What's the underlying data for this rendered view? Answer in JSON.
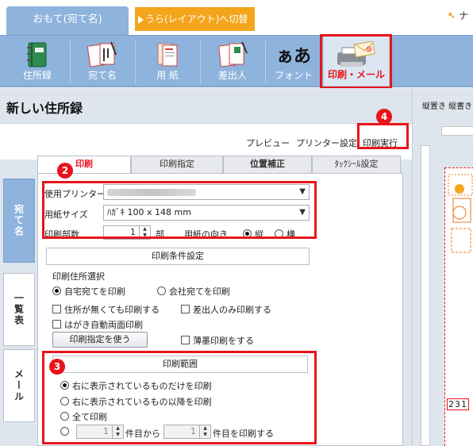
{
  "tabs": {
    "front": "おもて(宛て名)",
    "back": "うら(レイアウト)へ切替",
    "help": "ナ"
  },
  "toolbar": [
    {
      "label": "住所録",
      "icon": "address-book-icon"
    },
    {
      "label": "宛て名",
      "icon": "address-label-icon"
    },
    {
      "label": "用 紙",
      "icon": "paper-icon"
    },
    {
      "label": "差出人",
      "icon": "sender-icon"
    },
    {
      "label": "フォント",
      "icon": "font-icon",
      "glyph": "ぁあ"
    },
    {
      "label": "印刷・メール",
      "icon": "printer-mail-icon"
    }
  ],
  "title": "新しい住所録",
  "commands": {
    "preview": "プレビュー",
    "printer_setup": "プリンター設定",
    "print_exec": "印刷実行"
  },
  "side_tabs": [
    "宛て名",
    "一覧表",
    "メール"
  ],
  "print_tabs": [
    "印刷",
    "印刷指定",
    "位置補正",
    "ﾀｯｸｼｰﾙ設定"
  ],
  "form": {
    "printer_label": "使用プリンター",
    "paper_label": "用紙サイズ",
    "paper_value": "ﾊｶﾞｷ 100 x 148 mm",
    "copies_label": "印刷部数",
    "copies_value": "1",
    "copies_unit": "部",
    "orientation_label": "用紙の向き",
    "orientation_portrait": "縦",
    "orientation_landscape": "横"
  },
  "conditions": {
    "header": "印刷条件設定",
    "addr_select_label": "印刷住所選択",
    "home": "自宅宛てを印刷",
    "office": "会社宛てを印刷",
    "no_address": "住所が無くても印刷する",
    "sender_only": "差出人のみ印刷する",
    "duplex": "はがき自動両面印刷",
    "use_spec_button": "印刷指定を使う",
    "light_print": "薄墨印刷をする"
  },
  "range": {
    "header": "印刷範囲",
    "opt_shown_only": "右に表示されているものだけを印刷",
    "opt_shown_after": "右に表示されているもの以降を印刷",
    "opt_all": "全て印刷",
    "from_value": "1",
    "from_suffix": "件目から",
    "to_value": "1",
    "to_suffix": "件目を印刷する"
  },
  "badges": [
    "1",
    "2",
    "3",
    "4"
  ],
  "preview": {
    "tabs": "縦置き 縦書き",
    "postal": "231"
  },
  "colors": {
    "accent_blue": "#8eb3dc",
    "orange": "#f3a51b",
    "annotation_red": "#e8141c"
  }
}
